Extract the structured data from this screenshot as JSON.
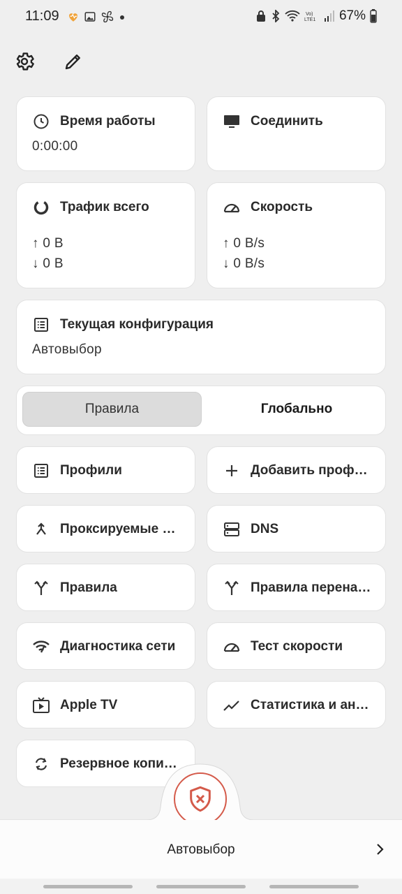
{
  "status_bar": {
    "time": "11:09",
    "battery_percent": "67%",
    "left_icons": [
      "heart-icon",
      "image-icon",
      "fan-icon",
      "dot-icon"
    ],
    "right_icons": [
      "vpn-lock-icon",
      "bluetooth-icon",
      "wifi-icon",
      "volte-icon",
      "signal-icon",
      "battery-icon"
    ]
  },
  "toolbar": {
    "settings_icon": "gear-icon",
    "edit_icon": "pencil-icon"
  },
  "cards": {
    "uptime": {
      "title": "Время работы",
      "value": "0:00:00",
      "icon": "clock-icon"
    },
    "connect": {
      "title": "Соединить",
      "icon": "monitor-icon"
    },
    "traffic": {
      "title": "Трафик всего",
      "up": "↑ 0 B",
      "down": "↓ 0 B",
      "icon": "donut-icon"
    },
    "speed": {
      "title": "Скорость",
      "up": "↑ 0 B/s",
      "down": "↓ 0 B/s",
      "icon": "speedometer-icon"
    },
    "config": {
      "title": "Текущая конфигурация",
      "value": "Автовыбор",
      "icon": "list-icon"
    }
  },
  "mode_switch": {
    "rules_label": "Правила",
    "global_label": "Глобально",
    "selected": "rules"
  },
  "menu": {
    "profiles": "Профили",
    "add_profile": "Добавить профиль",
    "proxied": "Проксируемые приложения",
    "dns": "DNS",
    "rules": "Правила",
    "rewrite_rules": "Правила перенаправления",
    "diagnostics": "Диагностика сети",
    "speedtest": "Тест скорости",
    "appletv": "Apple TV",
    "stats": "Статистика и аналитика",
    "backup": "Резервное копирование"
  },
  "bottom": {
    "label": "Автовыбор",
    "fab_icon": "shield-x-icon",
    "chevron_icon": "chevron-right-icon"
  },
  "colors": {
    "accent_red": "#d45a4a",
    "background": "#efefef",
    "card": "#ffffff",
    "segment_active": "#dcdcdc"
  }
}
